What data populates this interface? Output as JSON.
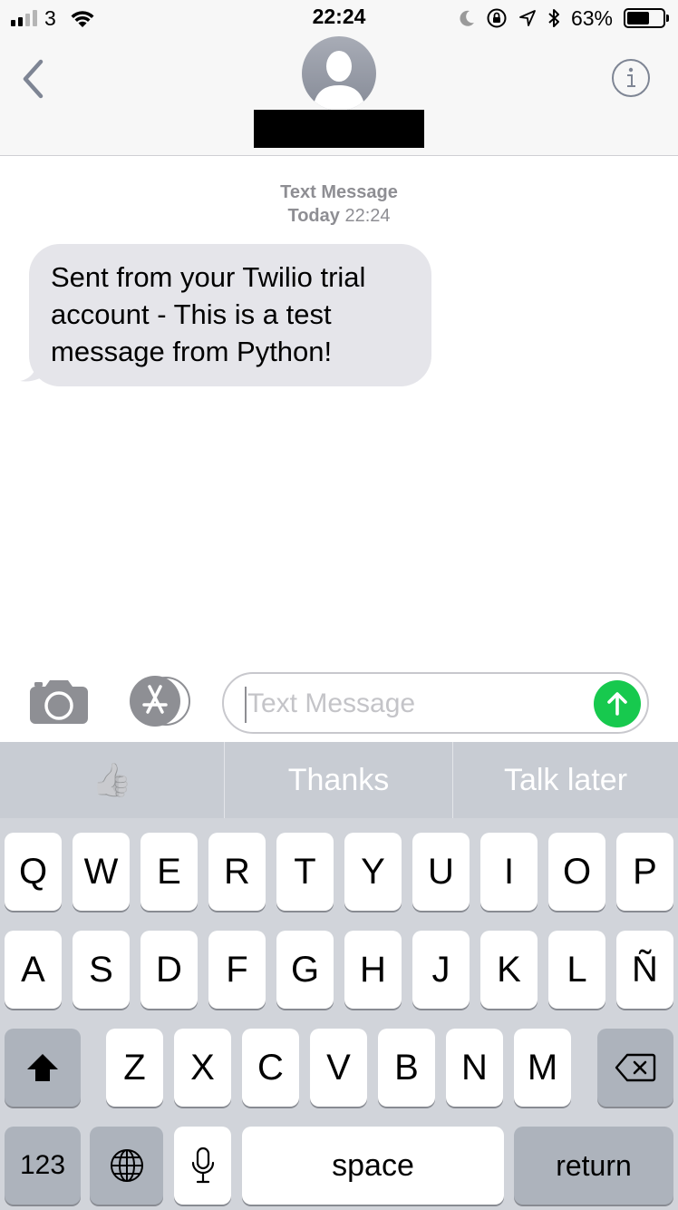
{
  "status_bar": {
    "carrier": "3",
    "time": "22:24",
    "battery_percent": "63%",
    "battery_level": 0.63,
    "signal_bars_filled": 2,
    "signal_bars_total": 4,
    "icons": [
      "wifi-icon",
      "moon-icon",
      "orientation-lock-icon",
      "location-icon",
      "bluetooth-icon",
      "battery-icon"
    ]
  },
  "header": {
    "contact_name": "",
    "icons": [
      "back-chevron-icon",
      "avatar-icon",
      "info-icon"
    ]
  },
  "conversation": {
    "service_label": "Text Message",
    "date_label": "Today",
    "time_label": "22:24",
    "messages": [
      {
        "direction": "incoming",
        "text": "Sent from your Twilio trial account - This is a test message from Python!"
      }
    ]
  },
  "compose": {
    "placeholder": "Text Message",
    "value": "",
    "icons": [
      "camera-icon",
      "app-store-icon",
      "send-arrow-icon"
    ],
    "send_color": "#17c94e"
  },
  "keyboard": {
    "suggestions": [
      "👍",
      "Thanks",
      "Talk later"
    ],
    "rows": [
      [
        "Q",
        "W",
        "E",
        "R",
        "T",
        "Y",
        "U",
        "I",
        "O",
        "P"
      ],
      [
        "A",
        "S",
        "D",
        "F",
        "G",
        "H",
        "J",
        "K",
        "L",
        "Ñ"
      ],
      [
        "Z",
        "X",
        "C",
        "V",
        "B",
        "N",
        "M"
      ]
    ],
    "numbers_label": "123",
    "space_label": "space",
    "return_label": "return",
    "icons": [
      "shift-icon",
      "delete-icon",
      "globe-icon",
      "microphone-icon"
    ]
  },
  "colors": {
    "bubble_incoming": "#e5e5ea",
    "header_bg": "#f7f7f7",
    "keyboard_bg": "#d1d4da",
    "timestamp_gray": "#8e8e93"
  }
}
